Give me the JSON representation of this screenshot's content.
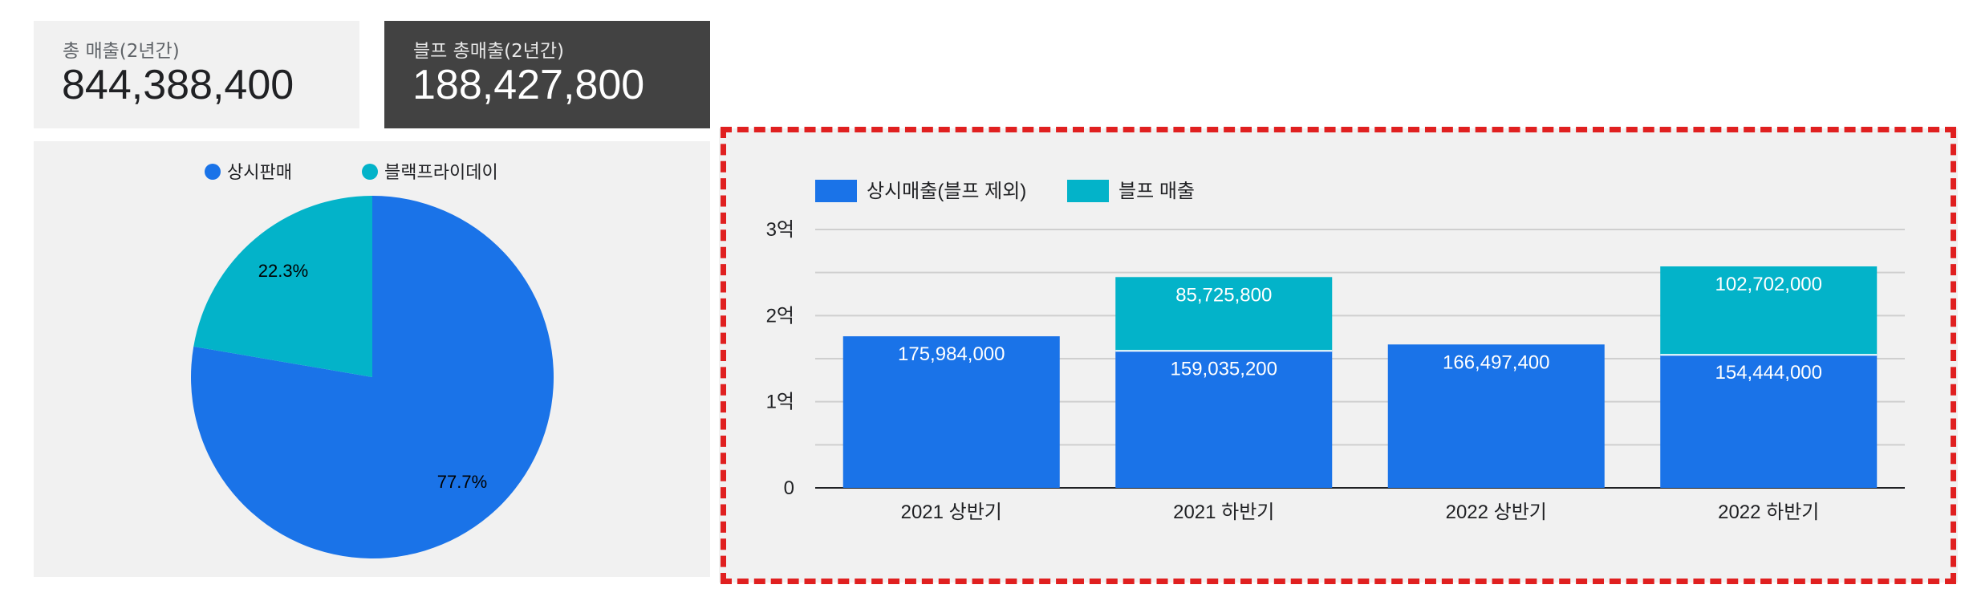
{
  "kpis": [
    {
      "label": "총 매출(2년간)",
      "value": "844,388,400"
    },
    {
      "label": "블프 총매출(2년간)",
      "value": "188,427,800"
    }
  ],
  "colors": {
    "regular": "#1a73e8",
    "blackfriday": "#03b3c9",
    "dashed_frame": "#e02020"
  },
  "chart_data": [
    {
      "type": "pie",
      "legend": [
        "상시판매",
        "블랙프라이데이"
      ],
      "values": [
        77.7,
        22.3
      ],
      "labels": [
        "77.7%",
        "22.3%"
      ],
      "legend_position": "top"
    },
    {
      "type": "bar",
      "stacked": true,
      "categories": [
        "2021 상반기",
        "2021 하반기",
        "2022 상반기",
        "2022 하반기"
      ],
      "series": [
        {
          "name": "상시매출(블프 제외)",
          "values": [
            175984000,
            159035200,
            166497400,
            154444000
          ],
          "labels": [
            "175,984,000",
            "159,035,200",
            "166,497,400",
            "154,444,000"
          ]
        },
        {
          "name": "블프 매출",
          "values": [
            0,
            85725800,
            0,
            102702000
          ],
          "labels": [
            "",
            "85,725,800",
            "",
            "102,702,000"
          ]
        }
      ],
      "yticks": [
        "0",
        "1억",
        "2억",
        "3억"
      ],
      "ylim": [
        0,
        300000000
      ],
      "legend_position": "top-left",
      "grid": true
    }
  ]
}
